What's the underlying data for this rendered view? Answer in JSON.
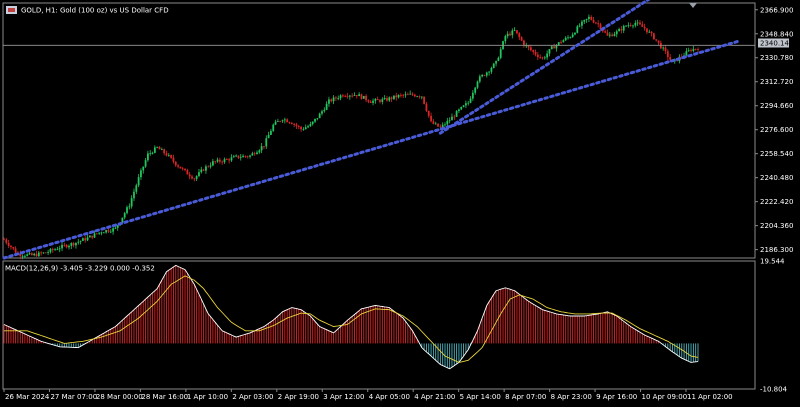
{
  "header": {
    "symbol_line": "GOLD, H1:  Gold (100 oz) vs US Dollar CFD",
    "indicator_line": "MACD(12,26,9) -3.405 -3.229 0.000 -0.352"
  },
  "current_price": "2340.140",
  "colors": {
    "background": "#000000",
    "bull": "#22c55e",
    "bear": "#dc2626",
    "trendline": "#4a5bd8",
    "macd_line": "#ffffff",
    "signal_line": "#e8d43a",
    "hist_pos": "#dc2626",
    "hist_neg": "#4fb5c0",
    "axis_text": "#ffffff"
  },
  "chart_data": [
    {
      "type": "candlestick",
      "symbol": "GOLD",
      "timeframe": "H1",
      "ylim": [
        2180,
        2372
      ],
      "y_ticks": [
        "2366.900",
        "2348.840",
        "2330.780",
        "2312.720",
        "2294.660",
        "2276.600",
        "2258.540",
        "2240.480",
        "2222.420",
        "2204.360",
        "2186.300"
      ],
      "x_ticks": [
        "26 Mar 2024",
        "27 Mar 07:00",
        "28 Mar 00:00",
        "28 Mar 16:00",
        "1 Apr 10:00",
        "2 Apr 03:00",
        "2 Apr 19:00",
        "3 Apr 12:00",
        "4 Apr 05:00",
        "4 Apr 21:00",
        "5 Apr 14:00",
        "8 Apr 07:00",
        "8 Apr 23:00",
        "9 Apr 16:00",
        "10 Apr 09:00",
        "11 Apr 02:00"
      ],
      "anchors": [
        [
          0,
          2194
        ],
        [
          6,
          2183
        ],
        [
          12,
          2182
        ],
        [
          18,
          2184
        ],
        [
          24,
          2188
        ],
        [
          30,
          2191
        ],
        [
          36,
          2195
        ],
        [
          42,
          2200
        ],
        [
          48,
          2202
        ],
        [
          54,
          2220
        ],
        [
          58,
          2240
        ],
        [
          62,
          2258
        ],
        [
          66,
          2263
        ],
        [
          70,
          2258
        ],
        [
          74,
          2251
        ],
        [
          78,
          2245
        ],
        [
          82,
          2240
        ],
        [
          86,
          2247
        ],
        [
          90,
          2252
        ],
        [
          96,
          2254
        ],
        [
          100,
          2256
        ],
        [
          106,
          2257
        ],
        [
          112,
          2265
        ],
        [
          116,
          2280
        ],
        [
          120,
          2285
        ],
        [
          124,
          2282
        ],
        [
          128,
          2277
        ],
        [
          132,
          2280
        ],
        [
          136,
          2288
        ],
        [
          140,
          2298
        ],
        [
          146,
          2303
        ],
        [
          152,
          2303
        ],
        [
          158,
          2298
        ],
        [
          164,
          2299
        ],
        [
          170,
          2302
        ],
        [
          176,
          2303
        ],
        [
          180,
          2302
        ],
        [
          184,
          2282
        ],
        [
          188,
          2278
        ],
        [
          192,
          2284
        ],
        [
          196,
          2291
        ],
        [
          200,
          2297
        ],
        [
          204,
          2314
        ],
        [
          208,
          2320
        ],
        [
          212,
          2327
        ],
        [
          216,
          2347
        ],
        [
          220,
          2351
        ],
        [
          224,
          2341
        ],
        [
          228,
          2335
        ],
        [
          232,
          2330
        ],
        [
          236,
          2338
        ],
        [
          240,
          2343
        ],
        [
          244,
          2347
        ],
        [
          248,
          2355
        ],
        [
          252,
          2361
        ],
        [
          256,
          2356
        ],
        [
          260,
          2347
        ],
        [
          264,
          2350
        ],
        [
          268,
          2355
        ],
        [
          272,
          2357
        ],
        [
          276,
          2353
        ],
        [
          280,
          2346
        ],
        [
          284,
          2337
        ],
        [
          288,
          2327
        ],
        [
          292,
          2332
        ],
        [
          296,
          2337
        ],
        [
          299,
          2338
        ]
      ],
      "trendlines": [
        {
          "name": "long-support",
          "from": [
            0,
            2180
          ],
          "to": [
            316,
            2343
          ]
        },
        {
          "name": "steep-support",
          "from": [
            188,
            2274
          ],
          "to": [
            278,
            2375
          ]
        }
      ],
      "current_price_line": 2340.14
    },
    {
      "type": "macd",
      "params": "12,26,9",
      "ylim": [
        -10.804,
        19.544
      ],
      "y_ticks": [
        "19.544",
        "-10.804"
      ],
      "macd_anchors": [
        [
          0,
          4.5
        ],
        [
          8,
          2.5
        ],
        [
          16,
          0.5
        ],
        [
          24,
          -0.8
        ],
        [
          32,
          -1
        ],
        [
          40,
          1.5
        ],
        [
          48,
          4
        ],
        [
          54,
          7
        ],
        [
          60,
          10
        ],
        [
          66,
          13
        ],
        [
          70,
          17
        ],
        [
          74,
          18.5
        ],
        [
          78,
          17.5
        ],
        [
          82,
          14
        ],
        [
          88,
          7
        ],
        [
          94,
          3
        ],
        [
          100,
          1.5
        ],
        [
          106,
          2.5
        ],
        [
          112,
          4
        ],
        [
          116,
          5.5
        ],
        [
          120,
          7.5
        ],
        [
          124,
          8.5
        ],
        [
          128,
          8
        ],
        [
          132,
          6.5
        ],
        [
          136,
          4
        ],
        [
          142,
          2.5
        ],
        [
          148,
          5.5
        ],
        [
          154,
          8.2
        ],
        [
          160,
          9
        ],
        [
          166,
          8.5
        ],
        [
          172,
          6
        ],
        [
          176,
          3
        ],
        [
          180,
          -1
        ],
        [
          184,
          -3
        ],
        [
          188,
          -5
        ],
        [
          192,
          -6
        ],
        [
          196,
          -4.5
        ],
        [
          200,
          -1.5
        ],
        [
          204,
          3
        ],
        [
          208,
          9
        ],
        [
          212,
          12.5
        ],
        [
          216,
          13.2
        ],
        [
          220,
          12.5
        ],
        [
          226,
          10
        ],
        [
          232,
          8
        ],
        [
          238,
          7
        ],
        [
          244,
          6.5
        ],
        [
          250,
          6.5
        ],
        [
          256,
          7
        ],
        [
          260,
          7.5
        ],
        [
          264,
          6.5
        ],
        [
          270,
          4
        ],
        [
          276,
          2
        ],
        [
          282,
          0.5
        ],
        [
          288,
          -2
        ],
        [
          292,
          -3.5
        ],
        [
          296,
          -4.5
        ],
        [
          299,
          -4.3
        ]
      ],
      "signal_anchors": [
        [
          0,
          3
        ],
        [
          10,
          3
        ],
        [
          18,
          1.5
        ],
        [
          26,
          0
        ],
        [
          34,
          0.5
        ],
        [
          42,
          1.5
        ],
        [
          50,
          3
        ],
        [
          58,
          6
        ],
        [
          66,
          10
        ],
        [
          72,
          14
        ],
        [
          78,
          16
        ],
        [
          82,
          15
        ],
        [
          86,
          13
        ],
        [
          92,
          8.5
        ],
        [
          98,
          5
        ],
        [
          104,
          3
        ],
        [
          110,
          3
        ],
        [
          116,
          4.2
        ],
        [
          122,
          6
        ],
        [
          128,
          7.2
        ],
        [
          132,
          7
        ],
        [
          136,
          5.5
        ],
        [
          142,
          4
        ],
        [
          148,
          4.5
        ],
        [
          154,
          7
        ],
        [
          160,
          8.2
        ],
        [
          166,
          8
        ],
        [
          172,
          6.5
        ],
        [
          178,
          4
        ],
        [
          184,
          0.5
        ],
        [
          190,
          -3
        ],
        [
          196,
          -4.5
        ],
        [
          200,
          -4
        ],
        [
          206,
          -1
        ],
        [
          210,
          3
        ],
        [
          214,
          7
        ],
        [
          218,
          10.5
        ],
        [
          222,
          11.5
        ],
        [
          228,
          10.5
        ],
        [
          234,
          8.5
        ],
        [
          240,
          7.5
        ],
        [
          246,
          7
        ],
        [
          252,
          7
        ],
        [
          258,
          7.2
        ],
        [
          262,
          7.2
        ],
        [
          268,
          5.5
        ],
        [
          274,
          3.5
        ],
        [
          280,
          2
        ],
        [
          286,
          0.5
        ],
        [
          292,
          -1.5
        ],
        [
          296,
          -3
        ],
        [
          299,
          -3.3
        ]
      ]
    }
  ]
}
